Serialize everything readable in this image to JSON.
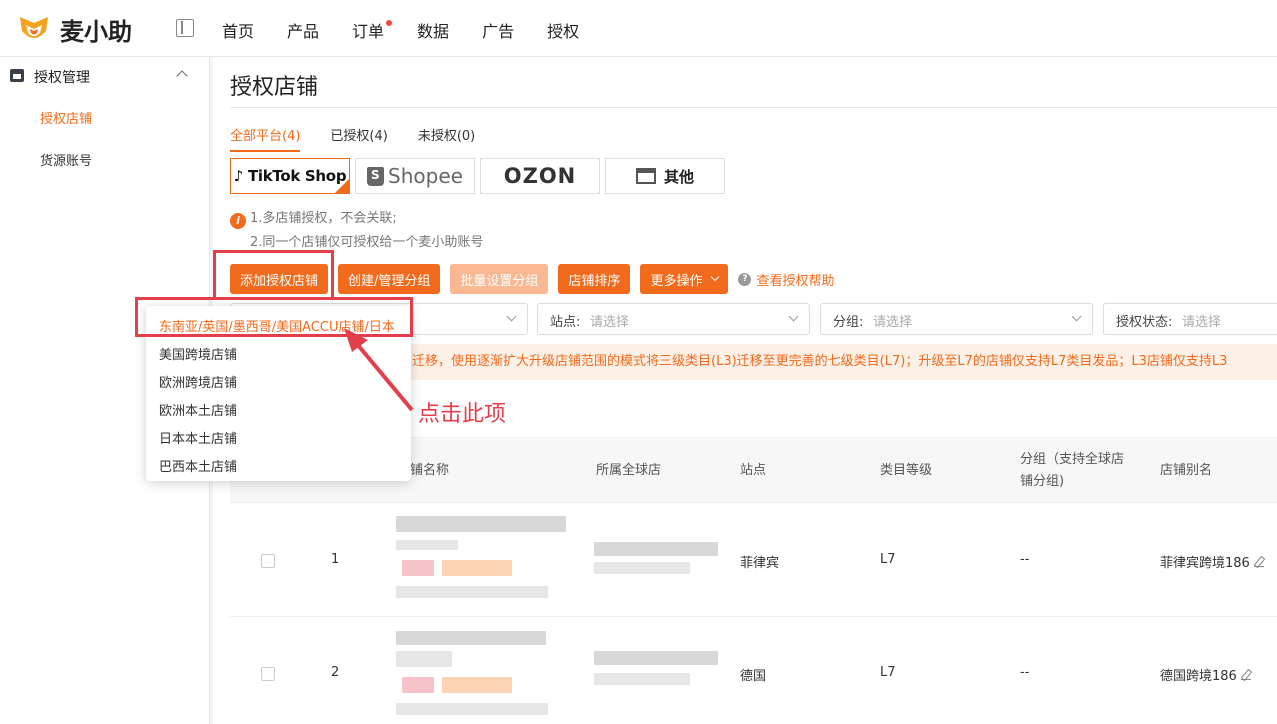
{
  "app": {
    "brand": "麦小助"
  },
  "nav": {
    "items": [
      {
        "label": "首页",
        "dot": false
      },
      {
        "label": "产品",
        "dot": false
      },
      {
        "label": "订单",
        "dot": true
      },
      {
        "label": "数据",
        "dot": false
      },
      {
        "label": "广告",
        "dot": false
      },
      {
        "label": "授权",
        "dot": false
      }
    ]
  },
  "sidebar": {
    "group_label": "授权管理",
    "items": [
      {
        "label": "授权店铺",
        "active": true
      },
      {
        "label": "货源账号",
        "active": false
      }
    ]
  },
  "page": {
    "title": "授权店铺",
    "tabs": [
      {
        "label": "全部平台(4)",
        "active": true
      },
      {
        "label": "已授权(4)",
        "active": false
      },
      {
        "label": "未授权(0)",
        "active": false
      }
    ],
    "platforms": {
      "tiktok": "TikTok Shop",
      "shopee": "Shopee",
      "ozon": "OZON",
      "other": "其他"
    },
    "notice": {
      "line1": "1.多店铺授权，不会关联;",
      "line2": "2.同一个店铺仅可授权给一个麦小助账号"
    },
    "toolbar": {
      "add_store": "添加授权店铺",
      "manage_groups": "创建/管理分组",
      "batch_group": "批量设置分组",
      "sort_stores": "店铺排序",
      "more_actions": "更多操作",
      "help": "查看授权帮助"
    },
    "filters": {
      "site_label": "站点:",
      "site_placeholder": "请选择",
      "group_label": "分组:",
      "group_placeholder": "请选择",
      "status_label": "授权状态:",
      "status_placeholder": "请选择"
    },
    "alert": "迁移，使用逐渐扩大升级店铺范围的模式将三级类目(L3)迁移至更完善的七级类目(L7)；升级至L7的店铺仅支持L7类目发品；L3店铺仅支持L3"
  },
  "table": {
    "headers": {
      "name": "铺名称",
      "global": "所属全球店",
      "site": "站点",
      "category": "类目等级",
      "group_line1": "分组（支持全球店",
      "group_line2": "铺分组)",
      "alias": "店铺别名"
    },
    "rows": [
      {
        "index": "1",
        "site": "菲律宾",
        "level": "L7",
        "group": "--",
        "alias": "菲律宾跨境186"
      },
      {
        "index": "2",
        "site": "德国",
        "level": "L7",
        "group": "--",
        "alias": "德国跨境186"
      }
    ]
  },
  "dropdown": {
    "items": [
      "东南亚/英国/墨西哥/美国ACCU店铺/日本",
      "美国跨境店铺",
      "欧洲跨境店铺",
      "欧洲本土店铺",
      "日本本土店铺",
      "巴西本土店铺"
    ]
  },
  "annotation": {
    "text": "点击此项"
  },
  "colors": {
    "accent": "#f26a1b",
    "annotation": "#e53e4b"
  }
}
